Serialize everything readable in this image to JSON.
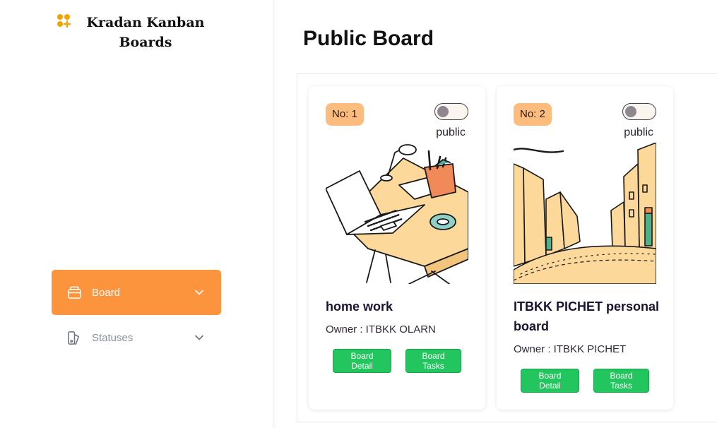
{
  "app": {
    "title": "Kradan Kanban Boards",
    "title_line1": "Kradan Kanban",
    "title_line2": "Boards",
    "brand_icon": "apps-plus-icon",
    "accent_color": "#fb943c"
  },
  "sidebar": {
    "items": [
      {
        "label": "Board",
        "icon": "board-icon",
        "active": true
      },
      {
        "label": "Statuses",
        "icon": "statuses-icon",
        "active": false
      }
    ]
  },
  "main": {
    "title": "Public Board",
    "boards": [
      {
        "number": "No: 1",
        "visibility": "public",
        "toggle_on": false,
        "name": "home work",
        "owner": "Owner : ITBKK OLARN",
        "image": "desk-laptop-illustration",
        "detail_label": "Board Detail",
        "tasks_label": "Board Tasks"
      },
      {
        "number": "No: 2",
        "visibility": "public",
        "toggle_on": false,
        "name": "ITBKK PICHET personal board",
        "owner": "Owner : ITBKK PICHET",
        "image": "city-street-illustration",
        "detail_label": "Board Detail",
        "tasks_label": "Board Tasks"
      }
    ]
  },
  "colors": {
    "badge": "#fcbc7e",
    "button": "#22c55e",
    "illustration_fill": "#fcd89a"
  }
}
